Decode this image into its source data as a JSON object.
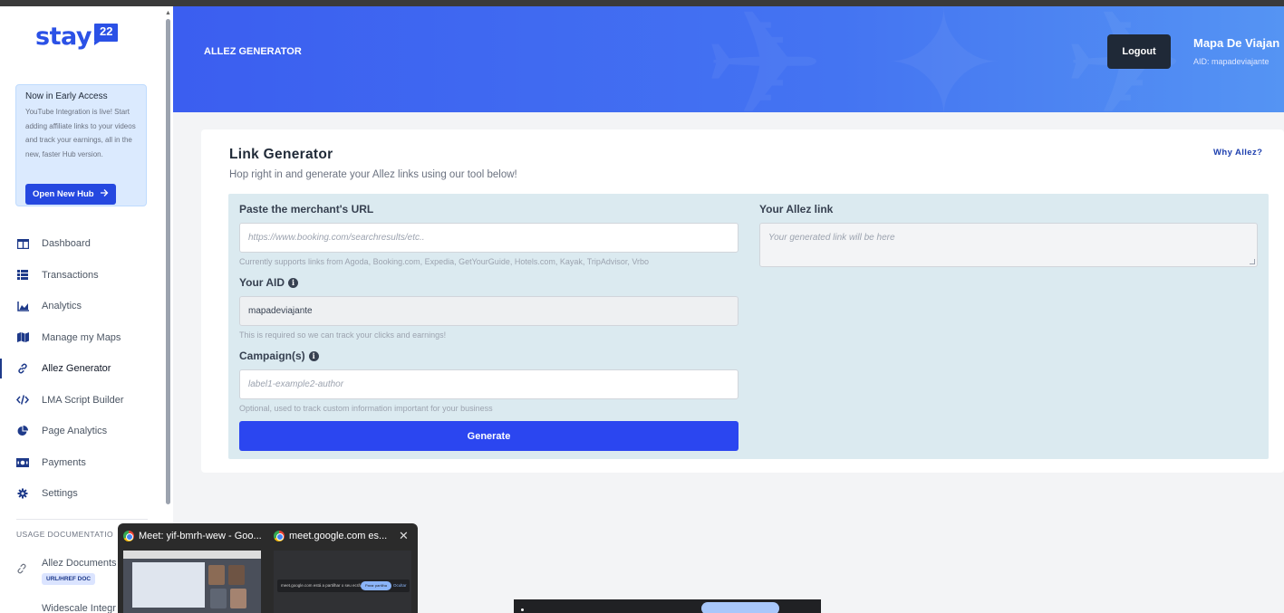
{
  "brand": {
    "logo_text": "stay",
    "logo_badge": "22"
  },
  "early_access": {
    "title": "Now in Early Access",
    "body": "YouTube Integration is live! Start adding affiliate links to your videos and track your earnings, all in the new, faster Hub version.",
    "button": "Open New Hub"
  },
  "nav": [
    {
      "label": "Dashboard",
      "icon": "dashboard-icon"
    },
    {
      "label": "Transactions",
      "icon": "list-icon"
    },
    {
      "label": "Analytics",
      "icon": "chart-icon"
    },
    {
      "label": "Manage my Maps",
      "icon": "map-icon"
    },
    {
      "label": "Allez Generator",
      "icon": "link-icon",
      "active": true
    },
    {
      "label": "LMA Script Builder",
      "icon": "code-icon"
    },
    {
      "label": "Page Analytics",
      "icon": "pie-chart-icon"
    },
    {
      "label": "Payments",
      "icon": "money-icon"
    },
    {
      "label": "Settings",
      "icon": "gear-icon"
    }
  ],
  "usage": {
    "label": "USAGE DOCUMENTATIO",
    "doc1": "Allez Documents",
    "doc1_badge": "URL/HREF DOC",
    "doc2": "Widescale Integr"
  },
  "header": {
    "title": "ALLEZ GENERATOR",
    "logout": "Logout",
    "user_name": "Mapa De Viajan",
    "user_aid": "AID: mapadeviajante"
  },
  "card": {
    "title": "Link Generator",
    "subtitle": "Hop right in and generate your Allez links using our tool below!",
    "why_link": "Why Allez?",
    "url_label": "Paste the merchant's URL",
    "url_placeholder": "https://www.booking.com/searchresults/etc..",
    "url_help": "Currently supports links from Agoda, Booking.com, Expedia, GetYourGuide, Hotels.com, Kayak, TripAdvisor, Vrbo",
    "aid_label": "Your AID",
    "aid_value": "mapadeviajante",
    "aid_help": "This is required so we can track your clicks and earnings!",
    "campaign_label": "Campaign(s)",
    "campaign_placeholder": "label1-example2-author",
    "campaign_help": "Optional, used to track custom information important for your business",
    "generate": "Generate",
    "output_label": "Your Allez link",
    "output_placeholder": "Your generated link will be here"
  },
  "taskbar_preview": {
    "tab1": "Meet: yif-bmrh-wew - Goo...",
    "tab2": "meet.google.com es...",
    "close": "✕",
    "share_text": "meet.google.com está a partilhar o seu ecrã.",
    "share_btn": "Parar partilha",
    "hide_btn": "Ocultar"
  },
  "colors": {
    "accent": "#2b46f0",
    "header_gradient_start": "#3b5ef0",
    "panel_bg": "#dbeaf0",
    "dark_button": "#1f2937"
  }
}
